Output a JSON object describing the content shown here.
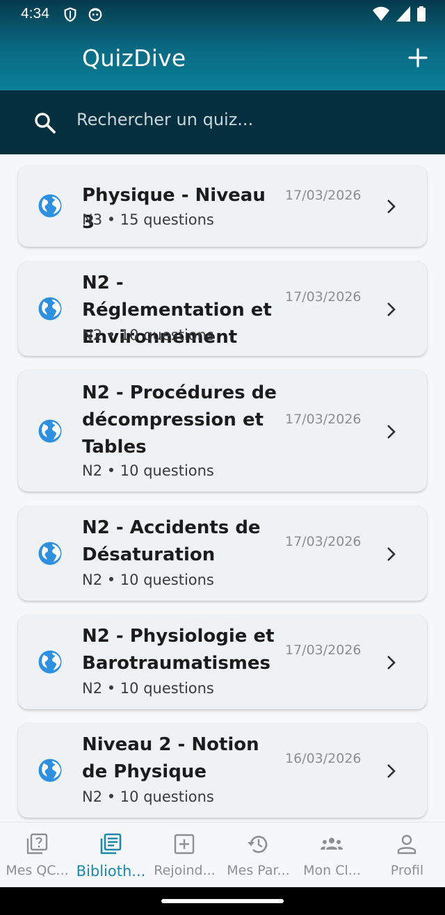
{
  "status_bar": {
    "time": "4:34"
  },
  "app_bar": {
    "title": "QuizDive"
  },
  "search": {
    "placeholder": "Rechercher un quiz..."
  },
  "quizzes": [
    {
      "title": "Physique - Niveau 3",
      "subtitle": "N3 • 15 questions",
      "date": "17/03/2026",
      "icon": "globe-icon"
    },
    {
      "title": "N2 - Réglementation et Environnement",
      "subtitle": "N2 • 10 questions",
      "date": "17/03/2026",
      "icon": "globe-icon"
    },
    {
      "title": "N2 - Procédures de décompression et Tables",
      "subtitle": "N2 • 10 questions",
      "date": "17/03/2026",
      "icon": "globe-icon"
    },
    {
      "title": "N2 - Accidents de Désaturation",
      "subtitle": "N2 • 10 questions",
      "date": "17/03/2026",
      "icon": "globe-icon"
    },
    {
      "title": "N2 - Physiologie et Barotraumatismes",
      "subtitle": "N2 • 10 questions",
      "date": "17/03/2026",
      "icon": "globe-icon"
    },
    {
      "title": "Niveau 2 - Notion de Physique",
      "subtitle": "N2 • 10 questions",
      "date": "16/03/2026",
      "icon": "globe-icon"
    }
  ],
  "bottom_nav": [
    {
      "label": "Mes QC...",
      "icon": "quiz-icon",
      "active": false
    },
    {
      "label": "Biblioth...",
      "icon": "library-icon",
      "active": true
    },
    {
      "label": "Rejoind...",
      "icon": "add-box-icon",
      "active": false
    },
    {
      "label": "Mes Par...",
      "icon": "history-icon",
      "active": false
    },
    {
      "label": "Mon Cl...",
      "icon": "group-icon",
      "active": false
    },
    {
      "label": "Profil",
      "icon": "person-icon",
      "active": false
    }
  ],
  "colors": {
    "accent": "#1e88a8",
    "globe": "#2f8fe0",
    "search_bar": "#042f3f"
  }
}
